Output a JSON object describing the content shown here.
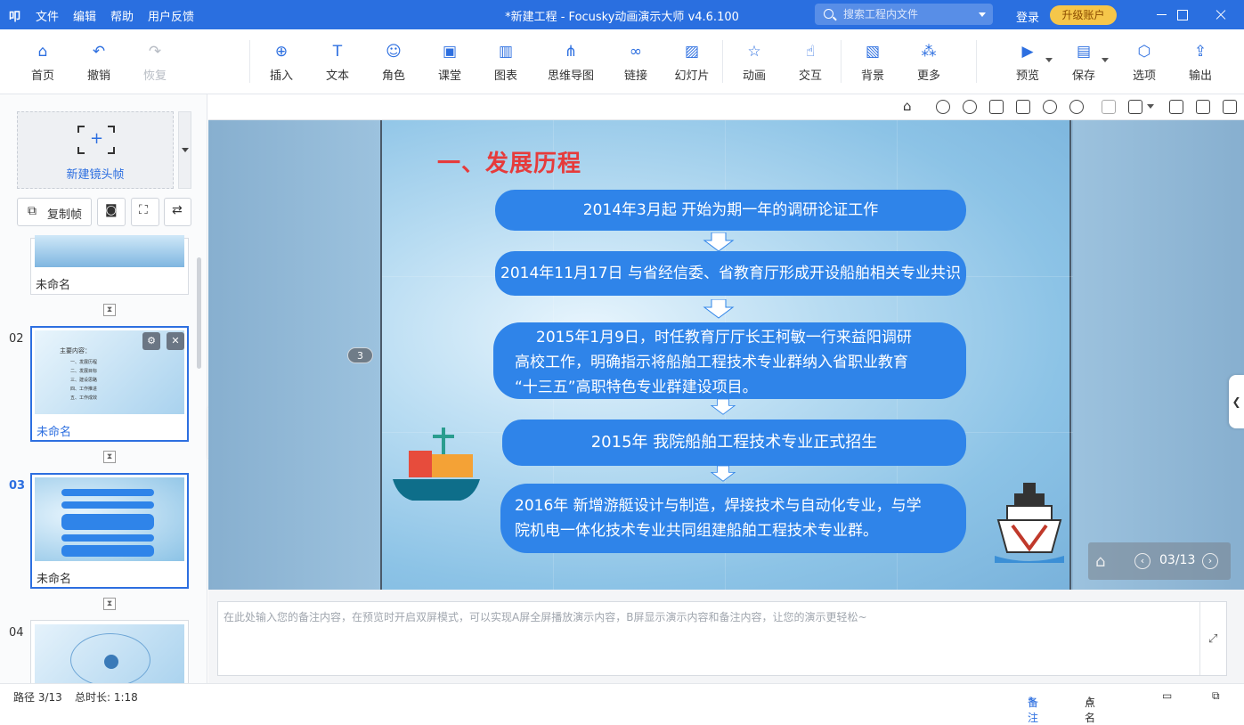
{
  "titlebar": {
    "logo": "叩",
    "menu": [
      "文件",
      "编辑",
      "帮助",
      "用户反馈"
    ],
    "title": "*新建工程 - Focusky动画演示大师  v4.6.100",
    "search_placeholder": "搜索工程内文件",
    "login": "登录",
    "upgrade": "升级账户"
  },
  "toolbar": {
    "home": "首页",
    "undo": "撤销",
    "redo": "恢复",
    "insert": "插入",
    "text": "文本",
    "role": "角色",
    "class": "课堂",
    "chart": "图表",
    "mindmap": "思维导图",
    "link": "链接",
    "slides": "幻灯片",
    "animation": "动画",
    "interact": "交互",
    "background": "背景",
    "more": "更多",
    "preview": "预览",
    "save": "保存",
    "options": "选项",
    "export": "输出"
  },
  "left": {
    "new_frame": "新建镜头帧",
    "copy_frame": "复制帧",
    "frames": [
      {
        "num": "",
        "name": "未命名"
      },
      {
        "num": "02",
        "name": "未命名"
      },
      {
        "num": "03",
        "name": "未命名"
      },
      {
        "num": "04",
        "name": ""
      }
    ],
    "thumb2_title": "主要内容：",
    "thumb2_items": [
      "一、发展历程",
      "二、发展目标",
      "三、建设思路",
      "四、工作推进",
      "五、工作成效"
    ]
  },
  "slide": {
    "title": "一、发展历程",
    "badge": "3",
    "items": [
      "2014年3月起 开始为期一年的调研论证工作",
      "2014年11月17日 与省经信委、省教育厅形成开设船舶相关专业共识",
      "2015年1月9日，时任教育厅厅长王柯敏一行来益阳调研高校工作，明确指示将船舶工程技术专业群纳入省职业教育“十三五”高职特色专业群建设项目。",
      "2015年 我院船舶工程技术专业正式招生",
      "2016年 新增游艇设计与制造，焊接技术与自动化专业，与学院机电一体化技术专业共同组建船舶工程技术专业群。"
    ],
    "item3_lines": [
      "2015年1月9日，时任教育厅厅长王柯敏一行来益阳调研",
      "高校工作，明确指示将船舶工程技术专业群纳入省职业教育",
      "“十三五”高职特色专业群建设项目。"
    ],
    "item5_lines": [
      "2016年 新增游艇设计与制造，焊接技术与自动化专业，与学",
      "院机电一体化技术专业共同组建船舶工程技术专业群。"
    ],
    "pager": "03/13"
  },
  "notes": {
    "placeholder": "在此处输入您的备注内容，在预览时开启双屏模式，可以实现A屏全屏播放演示内容，B屏显示演示内容和备注内容，让您的演示更轻松~"
  },
  "status": {
    "path": "路径 3/13",
    "duration": "总时长: 1:18",
    "notes_btn": "备注",
    "rollcall_btn": "点名"
  },
  "colors": {
    "brand": "#2a6fe0",
    "pill": "#2f84e9",
    "title_red": "#e63b3b",
    "upgrade": "#f5c64a"
  }
}
